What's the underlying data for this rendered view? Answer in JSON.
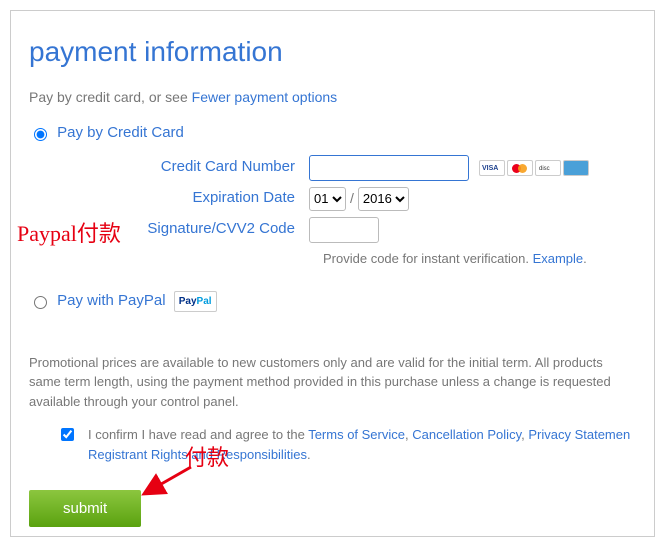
{
  "heading": "payment information",
  "intro_prefix": "Pay by credit card, or see ",
  "intro_link": "Fewer payment options",
  "option_cc": "Pay by Credit Card",
  "option_paypal": "Pay with PayPal",
  "labels": {
    "ccnum": "Credit Card Number",
    "exp": "Expiration Date",
    "cvv": "Signature/CVV2 Code"
  },
  "exp_month_selected": "01",
  "exp_year_selected": "2016",
  "hint_prefix": "Provide code for instant verification. ",
  "hint_link": "Example",
  "hint_suffix": ".",
  "disclaimer": "Promotional prices are available to new customers only and are valid for the initial term. All products same term length, using the payment method provided in this purchase unless a change is requested available through your control panel.",
  "confirm_prefix": "I confirm I have read and agree to the ",
  "confirm_links": {
    "tos": "Terms of Service",
    "cancel": "Cancellation Policy",
    "privacy": "Privacy Statemen",
    "registrant": "Registrant Rights and Responsibilities"
  },
  "confirm_sep": ", ",
  "confirm_end": ".",
  "submit_label": "submit",
  "annot_paypal": "Paypal付款",
  "annot_pay": "付款"
}
